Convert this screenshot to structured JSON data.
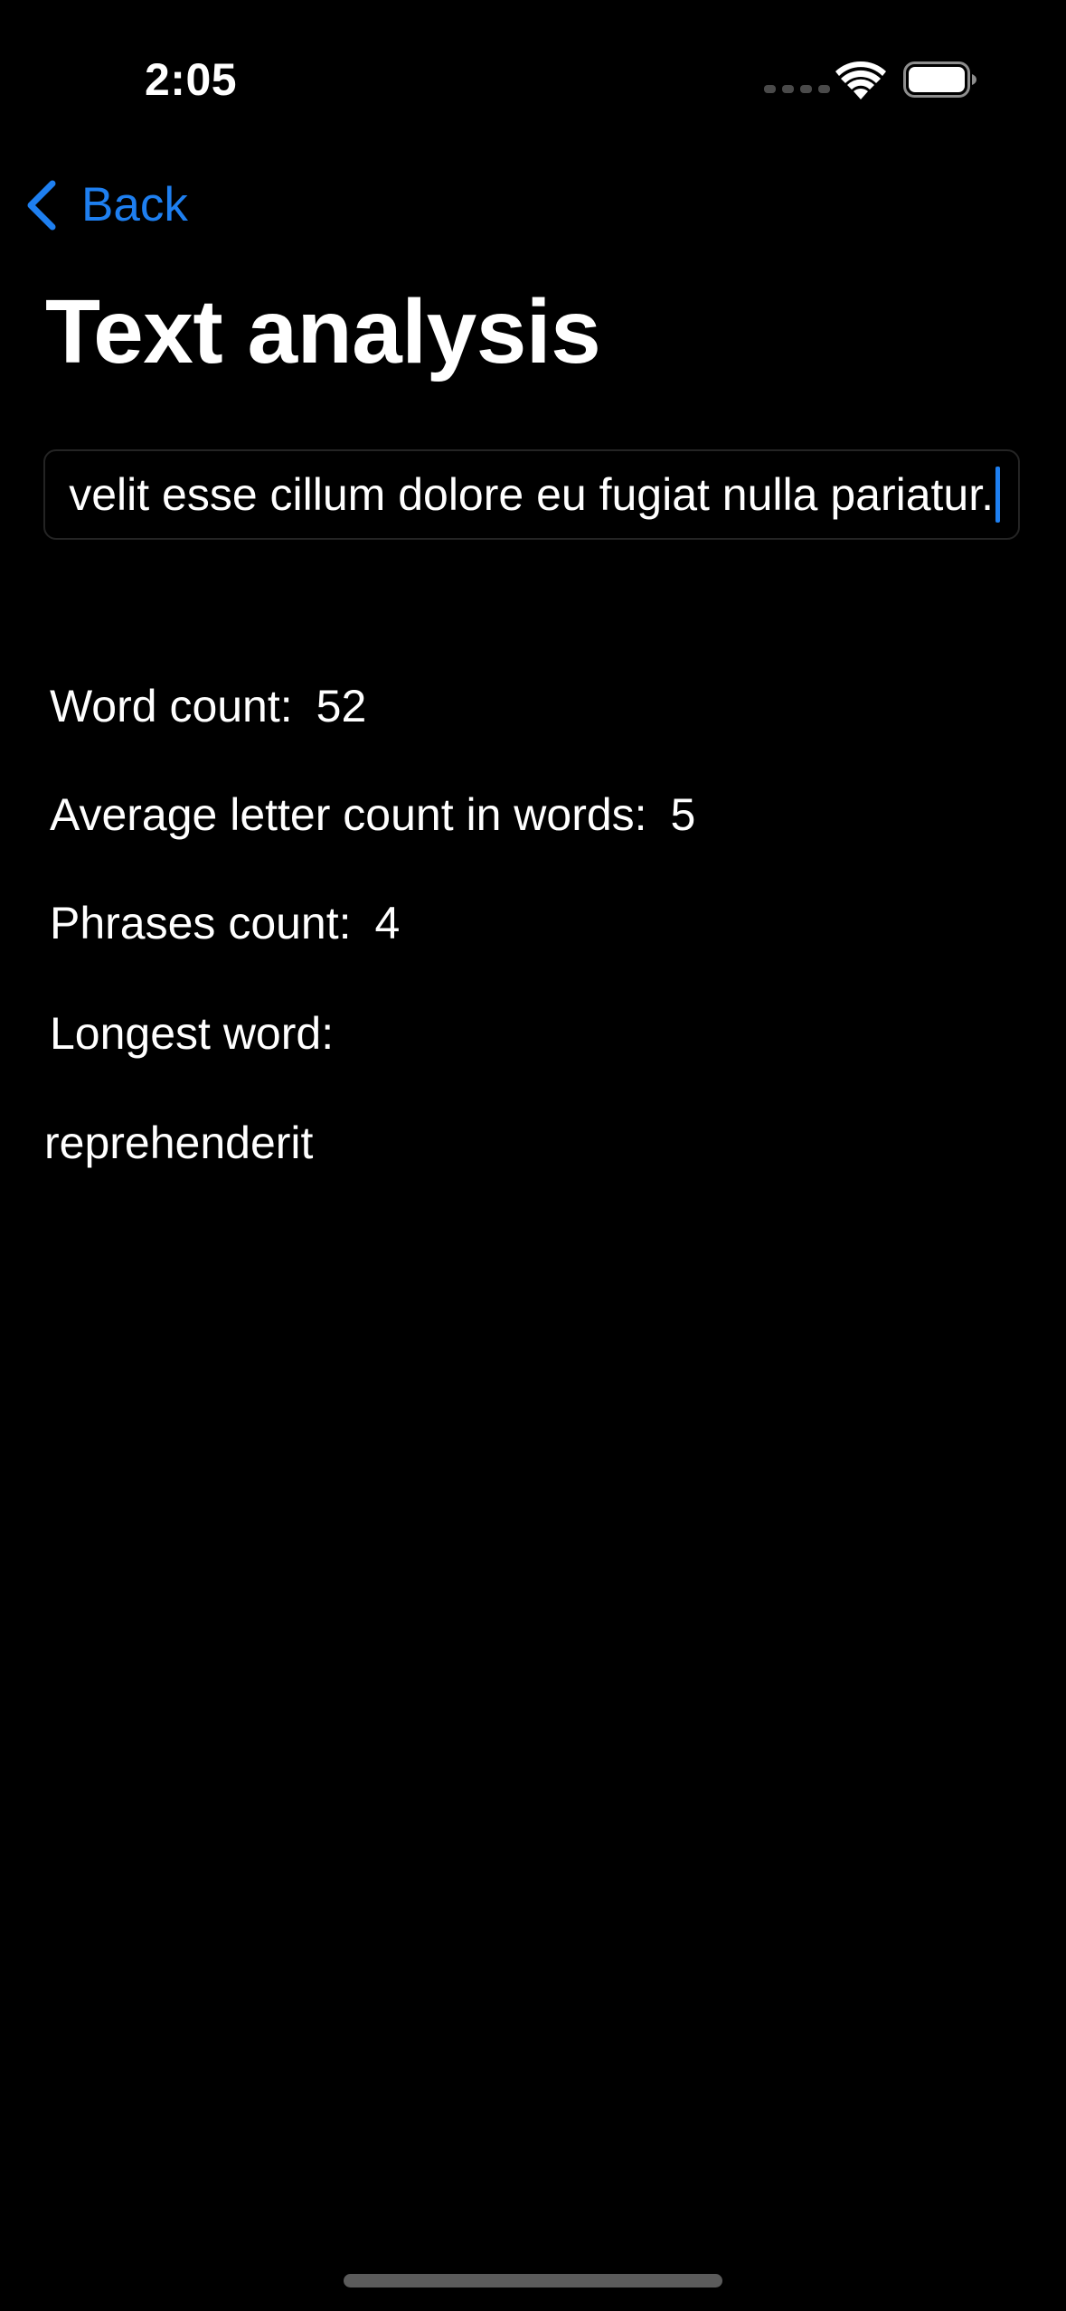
{
  "status_bar": {
    "time": "2:05",
    "icons": [
      "signal-dots-icon",
      "wifi-icon",
      "battery-icon"
    ]
  },
  "nav": {
    "back_label": "Back",
    "back_icon": "chevron-left-icon"
  },
  "title": "Text analysis",
  "text_input": {
    "value": "velit esse cillum dolore eu fugiat nulla pariatur."
  },
  "stats": {
    "word_count_label": "Word count:",
    "word_count_value": "52",
    "avg_letter_label": "Average letter count in words:",
    "avg_letter_value": "5",
    "phrases_label": "Phrases count:",
    "phrases_value": "4",
    "longest_word_label": "Longest word:",
    "longest_word_value": "reprehenderit"
  },
  "colors": {
    "background": "#000000",
    "text": "#ffffff",
    "accent": "#1e7ff0",
    "field_border": "#242424",
    "home_indicator": "#5b5b5b"
  }
}
